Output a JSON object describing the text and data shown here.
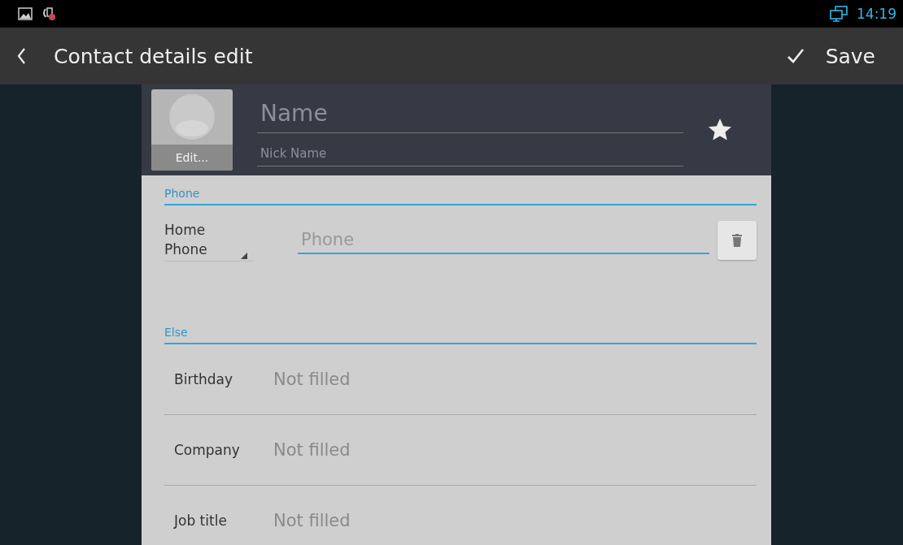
{
  "status_bar": {
    "time": "14:19"
  },
  "action_bar": {
    "title": "Contact details edit",
    "action": "Save"
  },
  "contact": {
    "photo_button": "Edit...",
    "name_placeholder": "Name",
    "nickname_placeholder": "Nick Name",
    "starred": true
  },
  "sections": [
    {
      "title": "Phone",
      "kind": "phone",
      "type_label": "Home\nPhone",
      "placeholder": "Phone"
    },
    {
      "title": "Else",
      "kind": "fields",
      "rows": [
        {
          "label": "Birthday",
          "value": "Not filled"
        },
        {
          "label": "Company",
          "value": "Not filled"
        },
        {
          "label": "Job title",
          "value": "Not filled"
        }
      ]
    }
  ]
}
